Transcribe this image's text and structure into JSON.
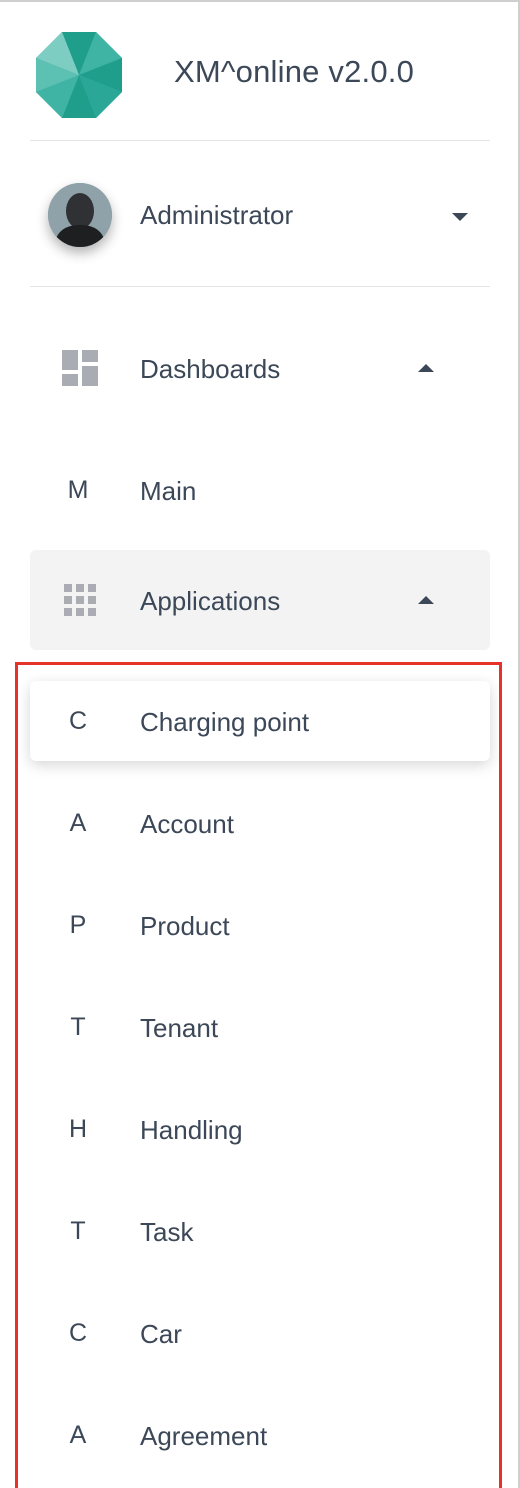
{
  "app": {
    "title": "XM^online v2.0.0",
    "logo_icon": "octagon-logo-icon",
    "colors": {
      "logo_dark": "#1f9e8c",
      "logo_mid": "#3fb3a4",
      "logo_light": "#7ecdc2"
    }
  },
  "user": {
    "name": "Administrator",
    "avatar_icon": "user-avatar",
    "toggle_icon": "caret-down-icon"
  },
  "nav": {
    "dashboards": {
      "label": "Dashboards",
      "icon": "dashboard-icon",
      "toggle_icon": "caret-up-icon"
    },
    "main": {
      "mini": "M",
      "label": "Main"
    },
    "applications": {
      "label": "Applications",
      "icon": "apps-grid-icon",
      "toggle_icon": "caret-up-icon"
    },
    "app_items": [
      {
        "mini": "C",
        "label": "Charging point"
      },
      {
        "mini": "A",
        "label": "Account"
      },
      {
        "mini": "P",
        "label": "Product"
      },
      {
        "mini": "T",
        "label": "Tenant"
      },
      {
        "mini": "H",
        "label": "Handling"
      },
      {
        "mini": "T",
        "label": "Task"
      },
      {
        "mini": "C",
        "label": "Car"
      },
      {
        "mini": "A",
        "label": "Agreement"
      }
    ]
  },
  "annotation": {
    "color": "#e63329"
  }
}
